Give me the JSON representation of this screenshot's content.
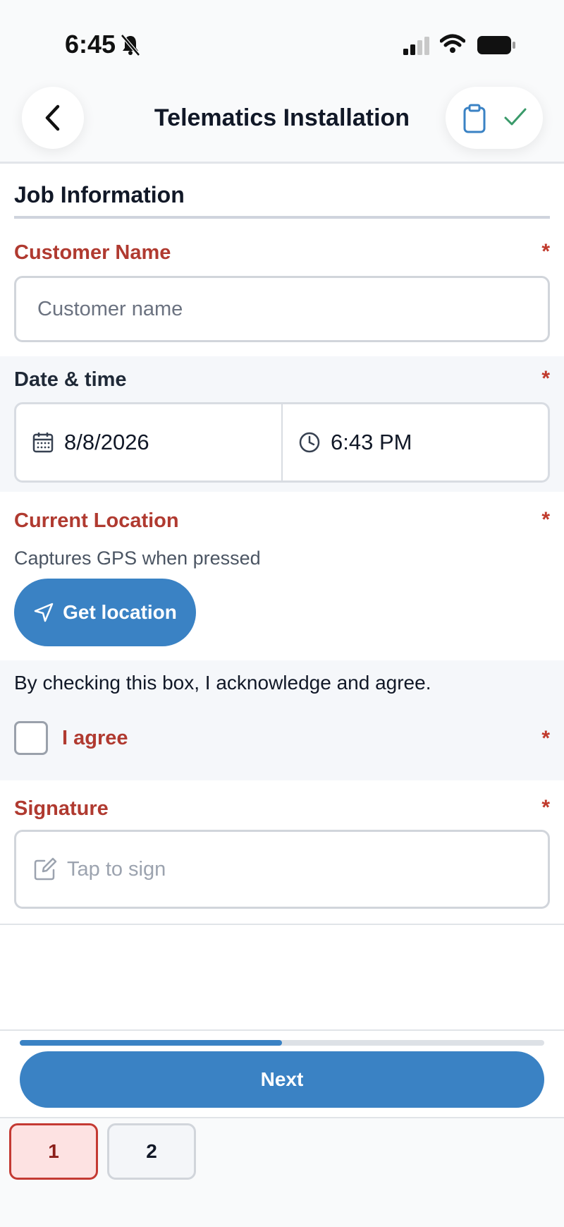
{
  "status_bar": {
    "time": "6:45"
  },
  "header": {
    "title": "Telematics Installation"
  },
  "section": {
    "title": "Job Information"
  },
  "customer_name": {
    "label": "Customer Name",
    "required": "*",
    "placeholder": "Customer name"
  },
  "date_time": {
    "label": "Date & time",
    "required": "*",
    "date": "8/8/2026",
    "time": "6:43 PM"
  },
  "location": {
    "label": "Current Location",
    "required": "*",
    "helper": "Captures GPS when pressed",
    "button_label": "Get location"
  },
  "agreement": {
    "text": "By checking this box, I acknowledge and agree.",
    "label": "I agree",
    "required": "*",
    "checked": false
  },
  "signature": {
    "label": "Signature",
    "required": "*",
    "placeholder": "Tap to sign"
  },
  "progress": {
    "fraction": 0.5
  },
  "next_button": {
    "label": "Next"
  },
  "pager": {
    "pages": [
      "1",
      "2"
    ],
    "active_page": "1"
  },
  "colors": {
    "accent": "#3a82c4",
    "required": "#b03a30",
    "confirm": "#3a9a6a"
  },
  "icons": [
    "bell-slash-icon",
    "signal-icon",
    "wifi-icon",
    "battery-icon",
    "chevron-left-icon",
    "clipboard-icon",
    "check-icon",
    "calendar-icon",
    "clock-icon",
    "navigation-arrow-icon",
    "edit-icon"
  ]
}
